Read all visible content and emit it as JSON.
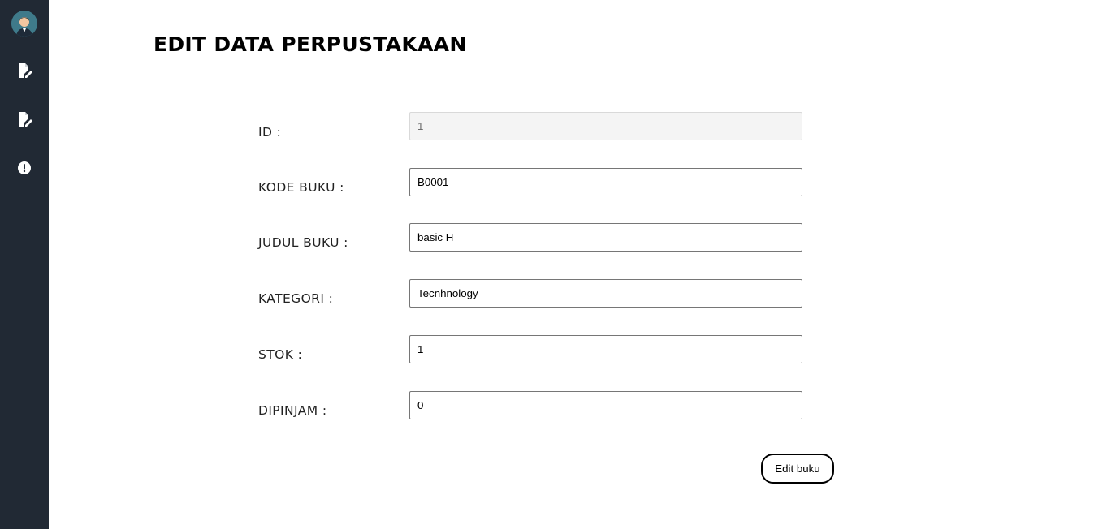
{
  "page_title": "EDIT DATA PERPUSTAKAAN",
  "sidebar": {
    "avatar_icon": "user-avatar-icon",
    "items": [
      {
        "icon": "edit-document-icon"
      },
      {
        "icon": "edit-document-icon"
      },
      {
        "icon": "alert-circle-icon"
      }
    ],
    "background": "#212934"
  },
  "form": {
    "fields": [
      {
        "label": "ID :",
        "value": "1",
        "disabled": true
      },
      {
        "label": "KODE BUKU :",
        "value": "B0001"
      },
      {
        "label": "JUDUL BUKU :",
        "value": "basic H"
      },
      {
        "label": "KATEGORI :",
        "value": "Tecnhnology"
      },
      {
        "label": "STOK :",
        "value": "1"
      },
      {
        "label": "DIPINJAM :",
        "value": "0"
      }
    ],
    "submit_label": "Edit buku"
  }
}
